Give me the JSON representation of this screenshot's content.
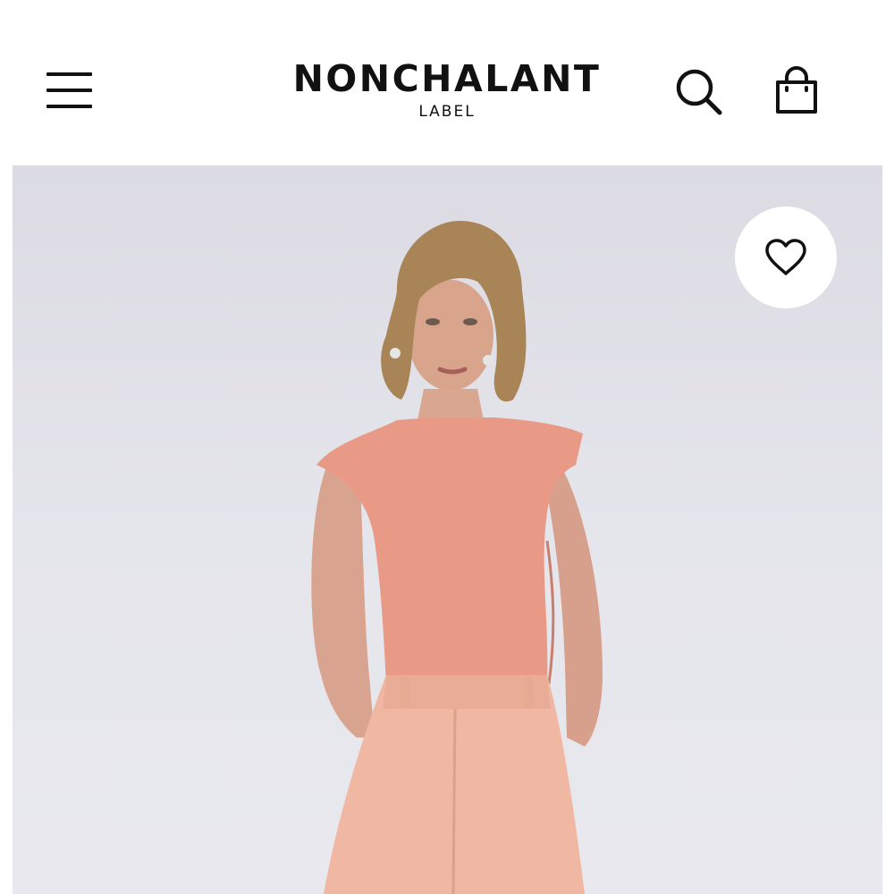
{
  "header": {
    "brand_name": "NONCHALANT",
    "brand_subtitle": "LABEL",
    "menu_icon": "hamburger-menu-icon",
    "search_icon": "search-icon",
    "bag_icon": "shopping-bag-icon"
  },
  "product_image": {
    "wishlist_icon": "heart-outline-icon"
  },
  "colors": {
    "background": "#ffffff",
    "text": "#111111",
    "photo_background": "#e3e3ea",
    "bodysuit": "#e99a86",
    "shorts": "#f0b8a2"
  }
}
